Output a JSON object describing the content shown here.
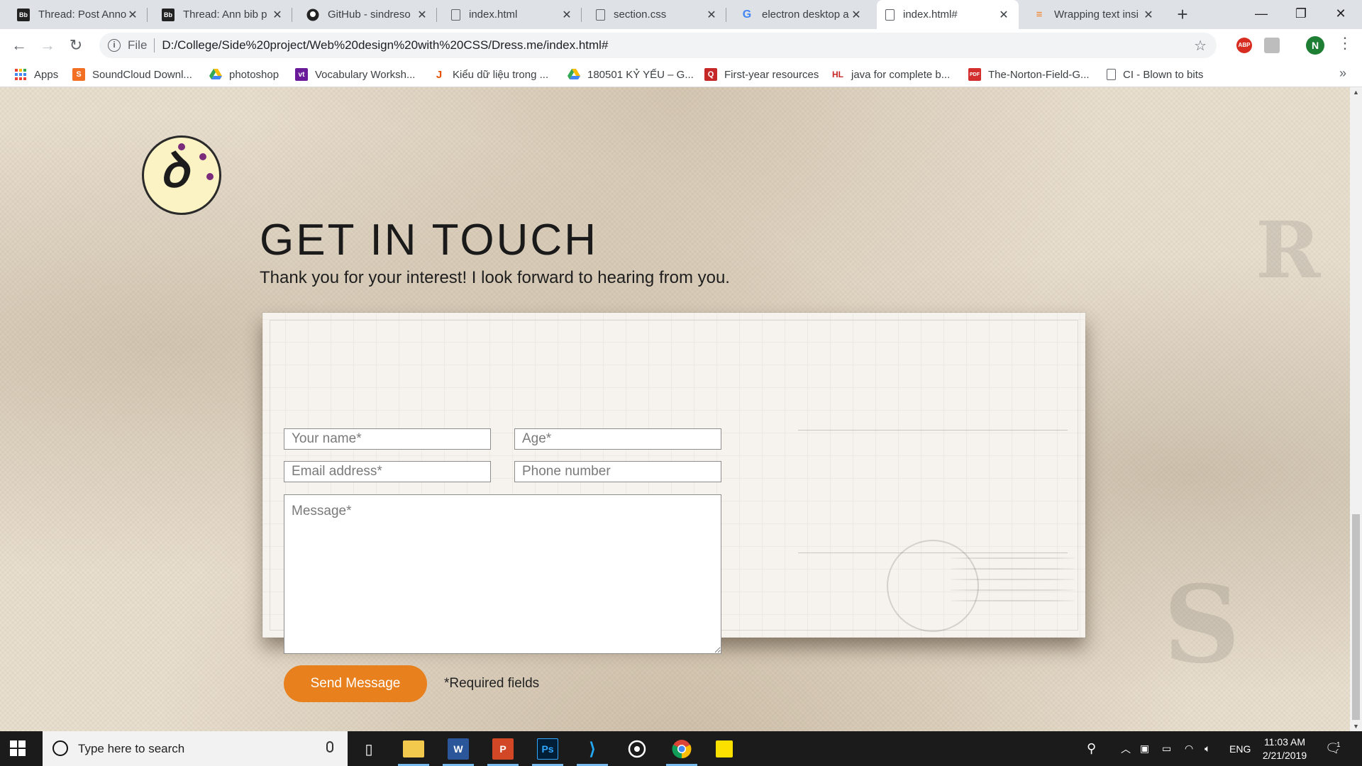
{
  "browser": {
    "tabs": [
      {
        "title": "Thread: Post Anno",
        "icon": "blackboard-icon",
        "active": false
      },
      {
        "title": "Thread: Ann bib p",
        "icon": "blackboard-icon",
        "active": false
      },
      {
        "title": "GitHub - sindreso",
        "icon": "github-icon",
        "active": false
      },
      {
        "title": "index.html",
        "icon": "file-icon",
        "active": false
      },
      {
        "title": "section.css",
        "icon": "file-icon",
        "active": false
      },
      {
        "title": "electron desktop a",
        "icon": "google-icon",
        "active": false
      },
      {
        "title": "index.html#",
        "icon": "file-icon",
        "active": true
      },
      {
        "title": "Wrapping text insi",
        "icon": "stackoverflow-icon",
        "active": false
      }
    ],
    "new_tab": "+",
    "window_controls": {
      "minimize": "—",
      "maximize": "❐",
      "close": "✕"
    },
    "address": {
      "scheme": "File",
      "url": "D:/College/Side%20project/Web%20design%20with%20CSS/Dress.me/index.html#"
    },
    "profile_initial": "N",
    "extensions": {
      "adblock": "ABP"
    },
    "bookmarks": [
      {
        "label": "Apps",
        "icon": "apps-grid-icon"
      },
      {
        "label": "SoundCloud Downl...",
        "icon": "soundcloud-icon"
      },
      {
        "label": "photoshop",
        "icon": "google-drive-icon"
      },
      {
        "label": "Vocabulary Worksh...",
        "icon": "vt-icon"
      },
      {
        "label": "Kiểu dữ liệu trong ...",
        "icon": "j-icon"
      },
      {
        "label": "180501 KỶ YẾU – G...",
        "icon": "google-drive-icon"
      },
      {
        "label": "First-year resources",
        "icon": "bookmark-red-icon"
      },
      {
        "label": "java for complete b...",
        "icon": "hl-icon"
      },
      {
        "label": "The-Norton-Field-G...",
        "icon": "pdf-icon"
      },
      {
        "label": "CI - Blown to bits",
        "icon": "file-icon"
      }
    ],
    "bookmarks_overflow": "»"
  },
  "page": {
    "title": "GET IN TOUCH",
    "subtitle": "Thank you for your interest! I look forward to hearing from you.",
    "form": {
      "name_placeholder": "Your name*",
      "age_placeholder": "Age*",
      "email_placeholder": "Email address*",
      "phone_placeholder": "Phone number",
      "message_placeholder": "Message*",
      "send_label": "Send Message",
      "required_note": "*Required fields"
    },
    "colors": {
      "accent": "#e8801e",
      "logo_bg": "#fbf3c4",
      "logo_dots": "#7b2c7a"
    }
  },
  "taskbar": {
    "search_placeholder": "Type here to search",
    "apps": [
      {
        "name": "task-view-icon"
      },
      {
        "name": "file-explorer-icon"
      },
      {
        "name": "word-icon",
        "glyph": "W"
      },
      {
        "name": "powerpoint-icon",
        "glyph": "P"
      },
      {
        "name": "photoshop-icon",
        "glyph": "Ps"
      },
      {
        "name": "vscode-icon"
      },
      {
        "name": "media-app-icon"
      },
      {
        "name": "chrome-icon"
      },
      {
        "name": "sticky-notes-icon"
      }
    ],
    "language": "ENG",
    "time": "11:03 AM",
    "date": "2/21/2019",
    "notification_count": "1"
  }
}
